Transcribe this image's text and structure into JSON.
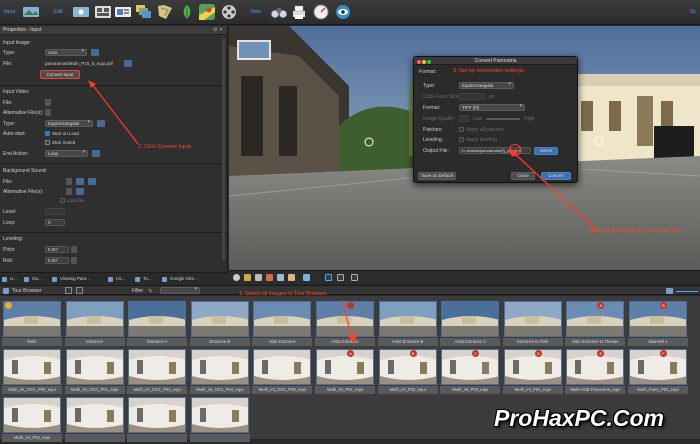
{
  "toolbar": {
    "input_label": "Input",
    "edit_label": "Edit",
    "view_label": "View",
    "right_label": "Sy"
  },
  "properties": {
    "title": "Properties - Input",
    "input_image": {
      "section": "Input Image:",
      "type_label": "Type:",
      "type_value": "Auto",
      "file_label": "File:",
      "file_value": "panoramas\\Muth_P15_b_equi.pdf",
      "convert_button": "Convert Input"
    },
    "input_video": {
      "section": "Input Video:",
      "file_label": "File:",
      "alt_label": "Alternative File(s):",
      "type_label": "Type:",
      "type_value": "Equirectangular",
      "autostart_label": "Auto-start:",
      "start_on_load": "Start on Load",
      "start_muted": "Start muted",
      "end_action_label": "End Action:",
      "end_action_value": "Loop"
    },
    "background_sound": {
      "section": "Background Sound:",
      "file_label": "File:",
      "alt_label": "Alternative File(s):",
      "play_note": "Loop file",
      "level_label": "Level:",
      "loop_label": "Loop:",
      "loop_value": "0"
    },
    "leveling": {
      "section": "Leveling:",
      "pitch_label": "Pitch:",
      "pitch_value": "0.00°",
      "roll_label": "Roll:",
      "roll_value": "0.00°"
    },
    "annotation_click": "2. Click Convert Input."
  },
  "tabs": [
    "U...",
    "Ou...",
    "Viewing Para...",
    "Us...",
    "To...",
    "Google Stre..."
  ],
  "browser": {
    "title": "Tour Browser",
    "filter_label": "Filter",
    "annotation_select": "1. Select all images in Tour Browser."
  },
  "thumbs_row1": [
    "Muth",
    "Entrance",
    "Entrance A",
    "Entrance B",
    "Side Entrance",
    "Artist Entrance",
    "Artist Entrance B",
    "Artist Entrance C",
    "Entrance to Park",
    "Side Entrance to Theater",
    "Stairwell A"
  ],
  "thumbs_row2": [
    "Muth_int_OG1_P00_equi",
    "Muth_int_OG1_P01_equi",
    "Muth_int_OG1_P03_equi",
    "Muth_int_OG1_P04_equi",
    "Muth_int_OG1_P05_equi",
    "Muth_int_P01_equi",
    "Muth_int_P02_equi",
    "Muth_int_P03_equi",
    "Muth_int_P04_equi",
    "Muth-ASB Panorama_equi",
    "Muth_Pano_P02_equi"
  ],
  "thumbs_row3": [
    "Muth_int_P04_equi",
    "",
    "",
    ""
  ],
  "badges_row1": {
    "5": "",
    "9": "A",
    "10": "B"
  },
  "badges_row2": {
    "5": "A",
    "6": "B",
    "7": "C",
    "8": "D",
    "9": "E",
    "10": "F",
    "11": "G"
  },
  "dialog": {
    "title": "Convert Panorama",
    "format_header": "Format:",
    "annotation_setup": "3. Set up conversion settings.",
    "type_label": "Type:",
    "type_value": "Equirectangular",
    "cube_face_label": "Cube Face Size:",
    "cube_face_unit": "px",
    "format_label": "Format:",
    "format_value": "TIFF (tif)",
    "quality_label": "Image Quality:",
    "quality_low": "Low",
    "quality_high": "High",
    "patches_label": "Patches:",
    "patches_value": "Apply all patches",
    "leveling_label": "Leveling:",
    "leveling_value": "Apply leveling",
    "output_label": "Output File:",
    "output_value": "t>-Assets\\panoramas\\{f}_{equi}.tif",
    "select_button": "Select",
    "save_default_button": "Save as Default",
    "close_button": "Close",
    "convert_button": "Convert",
    "annotation_output": "Adjust the file path for the output files here."
  },
  "watermark": "ProHaxPC.Com"
}
